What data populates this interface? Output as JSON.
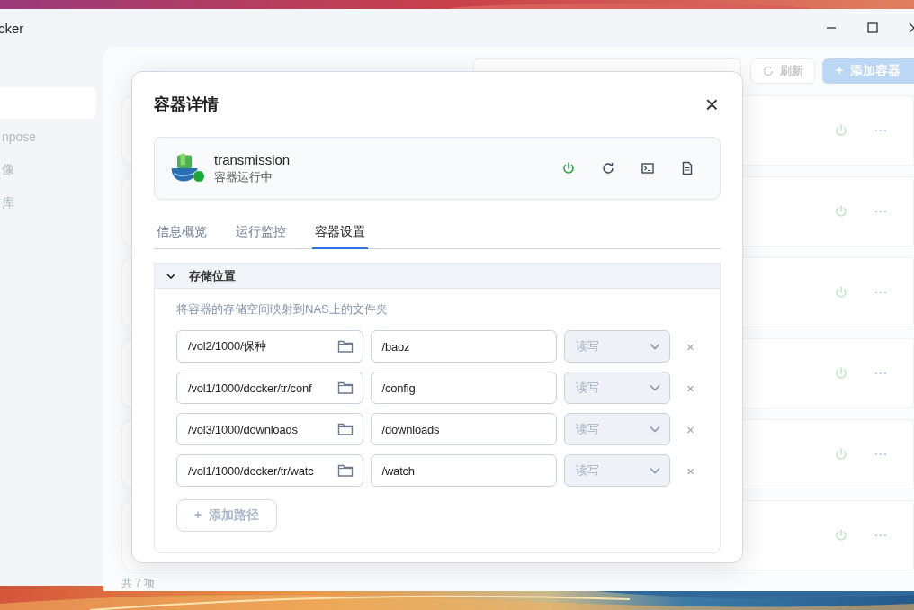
{
  "window": {
    "title": "cker"
  },
  "sidebar": {
    "items": [
      {
        "label": "npose"
      },
      {
        "label": "像"
      },
      {
        "label": "库"
      }
    ]
  },
  "main": {
    "refresh_button": "刷新",
    "add_button": {
      "icon": "+",
      "label": "添加容器"
    },
    "rows": [
      {
        "running": true
      },
      {
        "running": true
      },
      {
        "running": true
      },
      {
        "running": true
      },
      {
        "running": true
      },
      {
        "running": true
      }
    ],
    "footer": "共 7 项"
  },
  "dialog": {
    "title": "容器详情",
    "close": "×",
    "container": {
      "name": "transmission",
      "status": "容器运行中",
      "running": true
    },
    "tabs": [
      {
        "label": "信息概览",
        "selected": false
      },
      {
        "label": "运行监控",
        "selected": false
      },
      {
        "label": "容器设置",
        "selected": true
      }
    ],
    "section": {
      "title": "存储位置",
      "expanded": true,
      "description": "将容器的存储空间映射到NAS上的文件夹",
      "mounts": [
        {
          "host_path": "/vol2/1000/保种",
          "container_path": "/baoz",
          "mode": "读写",
          "mode_disabled": true,
          "remove": "×"
        },
        {
          "host_path": "/vol1/1000/docker/tr/conf",
          "container_path": "/config",
          "mode": "读写",
          "mode_disabled": true,
          "remove": "×"
        },
        {
          "host_path": "/vol3/1000/downloads",
          "container_path": "/downloads",
          "mode": "读写",
          "mode_disabled": true,
          "remove": "×"
        },
        {
          "host_path": "/vol1/1000/docker/tr/watc",
          "container_path": "/watch",
          "mode": "读写",
          "mode_disabled": true,
          "remove": "×"
        }
      ],
      "add_button": {
        "icon": "+",
        "label": "添加路径"
      }
    }
  }
}
